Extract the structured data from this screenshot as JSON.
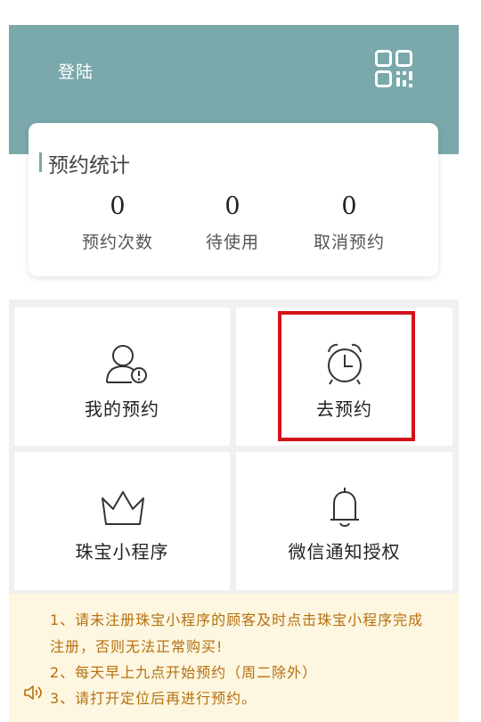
{
  "header": {
    "login_label": "登陆",
    "background_color": "#7aa8ab",
    "qr_icon": "qr-code-icon"
  },
  "stats": {
    "title": "预约统计",
    "items": [
      {
        "value": "0",
        "label": "预约次数"
      },
      {
        "value": "0",
        "label": "待使用"
      },
      {
        "value": "0",
        "label": "取消预约"
      }
    ]
  },
  "tiles": [
    {
      "label": "我的预约",
      "icon": "user-alert-icon"
    },
    {
      "label": "去预约",
      "icon": "alarm-clock-icon",
      "highlighted": true
    },
    {
      "label": "珠宝小程序",
      "icon": "crown-icon"
    },
    {
      "label": "微信通知授权",
      "icon": "bell-icon"
    }
  ],
  "notice": {
    "lines": [
      "1、请未注册珠宝小程序的顾客及时点击珠宝小程序完成",
      "注册，否则无法正常购买!",
      "2、每天早上九点开始预约（周二除外）",
      "3、请打开定位后再进行预约。"
    ],
    "text_color": "#b5700f",
    "background_color": "#fdf6e0",
    "speaker_icon": "speaker-icon"
  },
  "highlight_color": "#d4121a"
}
